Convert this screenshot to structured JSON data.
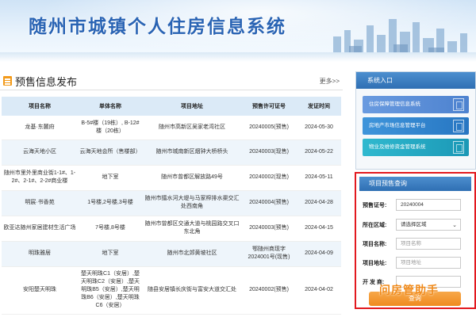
{
  "banner": {
    "title": "随州市城镇个人住房信息系统"
  },
  "presale": {
    "section_title": "预售信息发布",
    "more_label": "更多>>",
    "columns": [
      "项目名称",
      "单体名称",
      "项目地址",
      "预售许可证号",
      "发证时间"
    ],
    "rows": [
      [
        "龙基·东麓府",
        "B-5#楼（19栋）, B-12#楼（20栋）",
        "随州市高新区吴家老湾社区",
        "20240005(预售)",
        "2024-05-30"
      ],
      [
        "云海天地小区",
        "云海天地会所（售楼部）",
        "随州市城南新区烟钟大桥桥头",
        "20240003(现售)",
        "2024-05-22"
      ],
      [
        "随州市里外里商业街1-1#、1-2#、2-1#、2-2#商业楼",
        "地下室",
        "随州市曾都区解放路49号",
        "20240002(现售)",
        "2024-05-11"
      ],
      [
        "明宸·书香苑",
        "1号楼,2号楼,3号楼",
        "随州市擂水河大堤与马家榨排水渠交汇处西南角",
        "20240004(预售)",
        "2024-04-28"
      ],
      [
        "欧亚达随州家居建材生活广场",
        "7号楼,8号楼",
        "随州市曾都区交通大道与桃园路交叉口东北角",
        "20240003(预售)",
        "2024-04-15"
      ],
      [
        "明珠雅居",
        "地下室",
        "随州市北郊黄坡社区",
        "鄂随州商现字2024001号(现售)",
        "2024-04-09"
      ],
      [
        "安阳楚天明珠",
        "楚天明珠C1（安居）,楚天明珠C2（安居）,楚天明珠B5（安居）,楚天明珠B6（安居）,楚天明珠C6（安居）",
        "随县安居镇长庆街与富安大道交汇处",
        "20240002(预售)",
        "2024-04-02"
      ]
    ]
  },
  "system_entry": {
    "title": "系统入口",
    "buttons": [
      {
        "label": "住房保障管理信息系统",
        "color": "#5b8fd8"
      },
      {
        "label": "房地产市场信息管理平台",
        "color": "#2f86d0"
      },
      {
        "label": "物业及维修资金管理系统",
        "color": "#21a8c2"
      }
    ]
  },
  "query": {
    "title": "项目预售查询",
    "fields": [
      {
        "label": "预售证号:",
        "value": "20240004",
        "placeholder": ""
      },
      {
        "label": "所在区域:",
        "value": "请选择区域",
        "placeholder": ""
      },
      {
        "label": "项目名称:",
        "value": "",
        "placeholder": "项目名称"
      },
      {
        "label": "项目地址:",
        "value": "",
        "placeholder": "项目地址"
      },
      {
        "label": "开 发 商:",
        "value": "",
        "placeholder": ""
      }
    ],
    "submit_label": "查询"
  },
  "watermark": "问房管助手"
}
